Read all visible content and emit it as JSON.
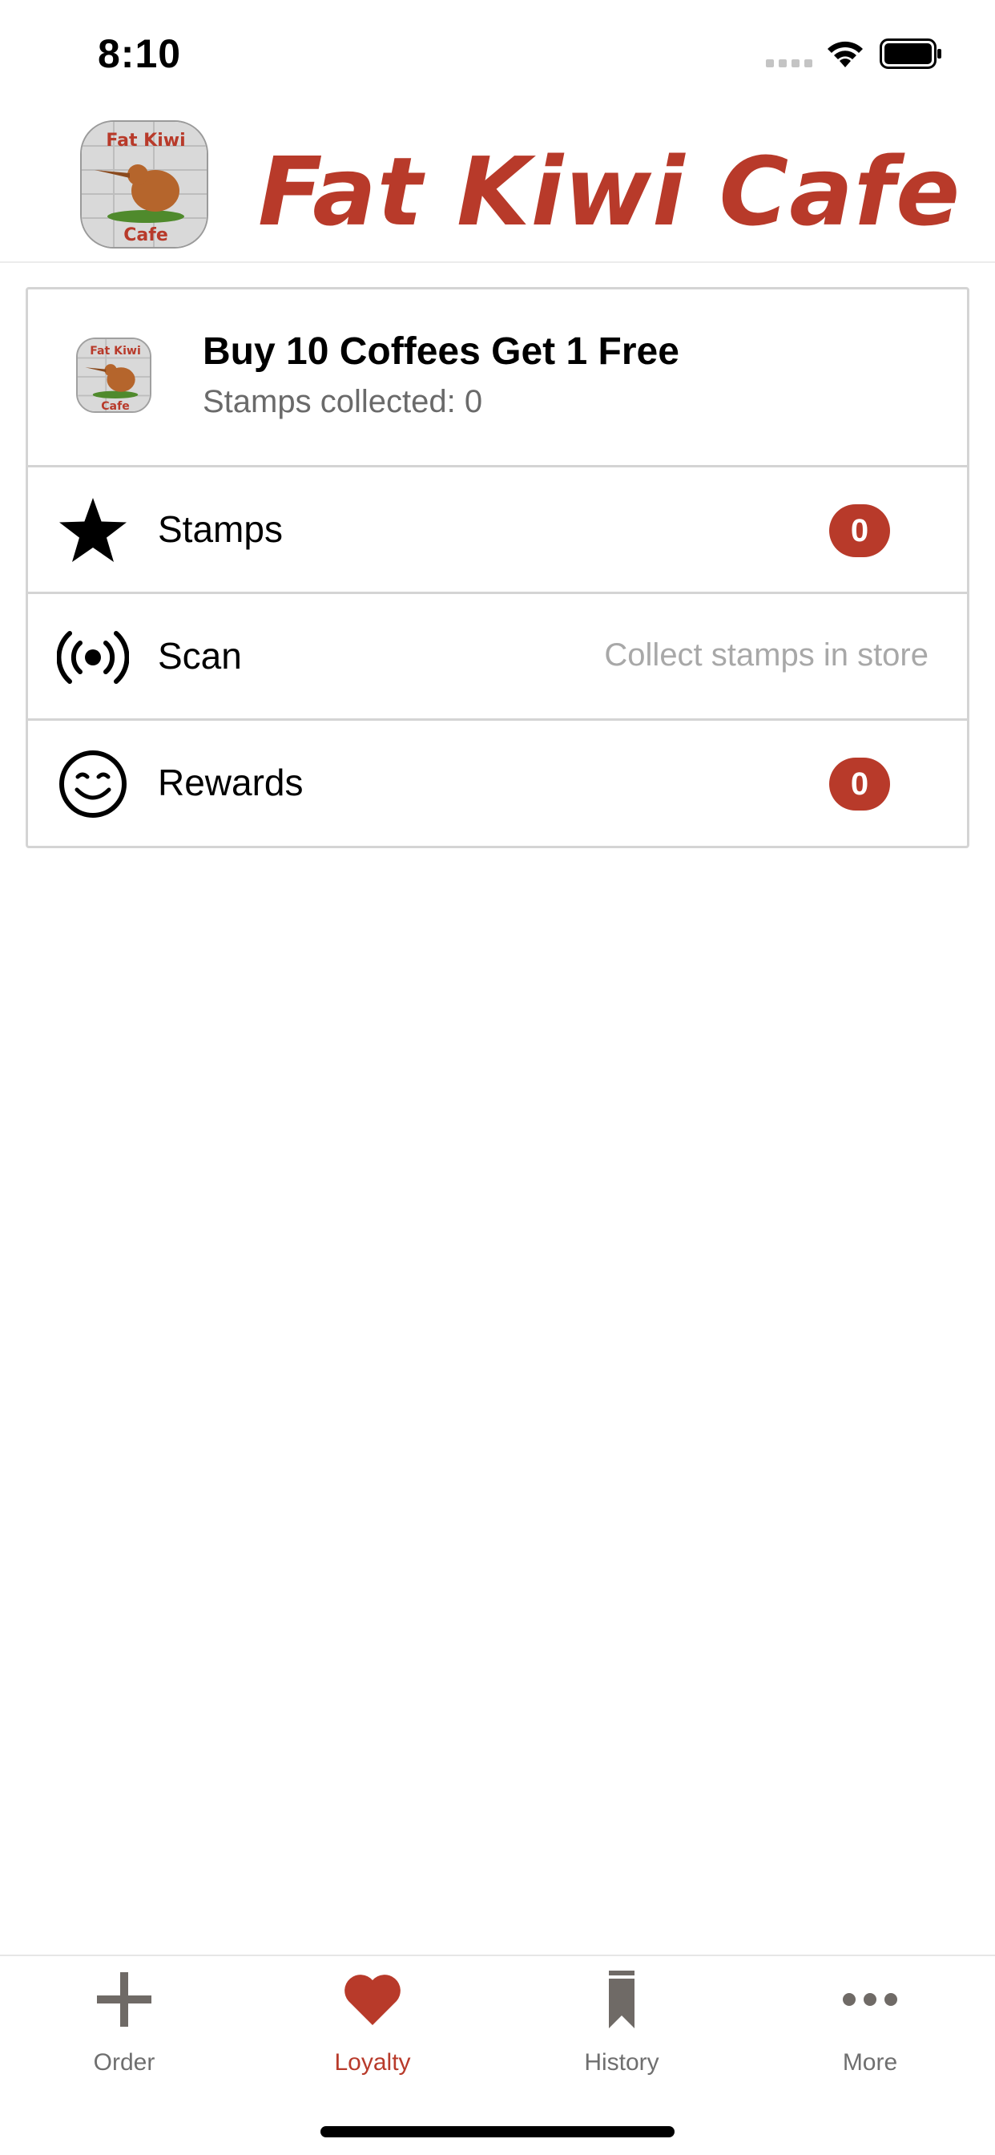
{
  "status_bar": {
    "time": "8:10"
  },
  "header": {
    "title": "Fat Kiwi Cafe",
    "logo_text_top": "Fat Kiwi",
    "logo_text_bottom": "Cafe"
  },
  "card": {
    "title": "Buy 10 Coffees Get 1 Free",
    "subtitle": "Stamps collected: 0",
    "rows": [
      {
        "label": "Stamps",
        "icon": "star-icon",
        "badge": "0"
      },
      {
        "label": "Scan",
        "icon": "nfc-scan-icon",
        "hint": "Collect stamps in store"
      },
      {
        "label": "Rewards",
        "icon": "smiley-icon",
        "badge": "0"
      }
    ]
  },
  "tabs": [
    {
      "label": "Order",
      "icon": "plus-icon",
      "active": false
    },
    {
      "label": "Loyalty",
      "icon": "heart-icon",
      "active": true
    },
    {
      "label": "History",
      "icon": "bookmark-icon",
      "active": false
    },
    {
      "label": "More",
      "icon": "ellipsis-icon",
      "active": false
    }
  ],
  "colors": {
    "accent": "#b83a2a",
    "tab_inactive": "#6f6f6f",
    "divider": "#d4d4d4",
    "hint_text": "#a8a8a8"
  }
}
